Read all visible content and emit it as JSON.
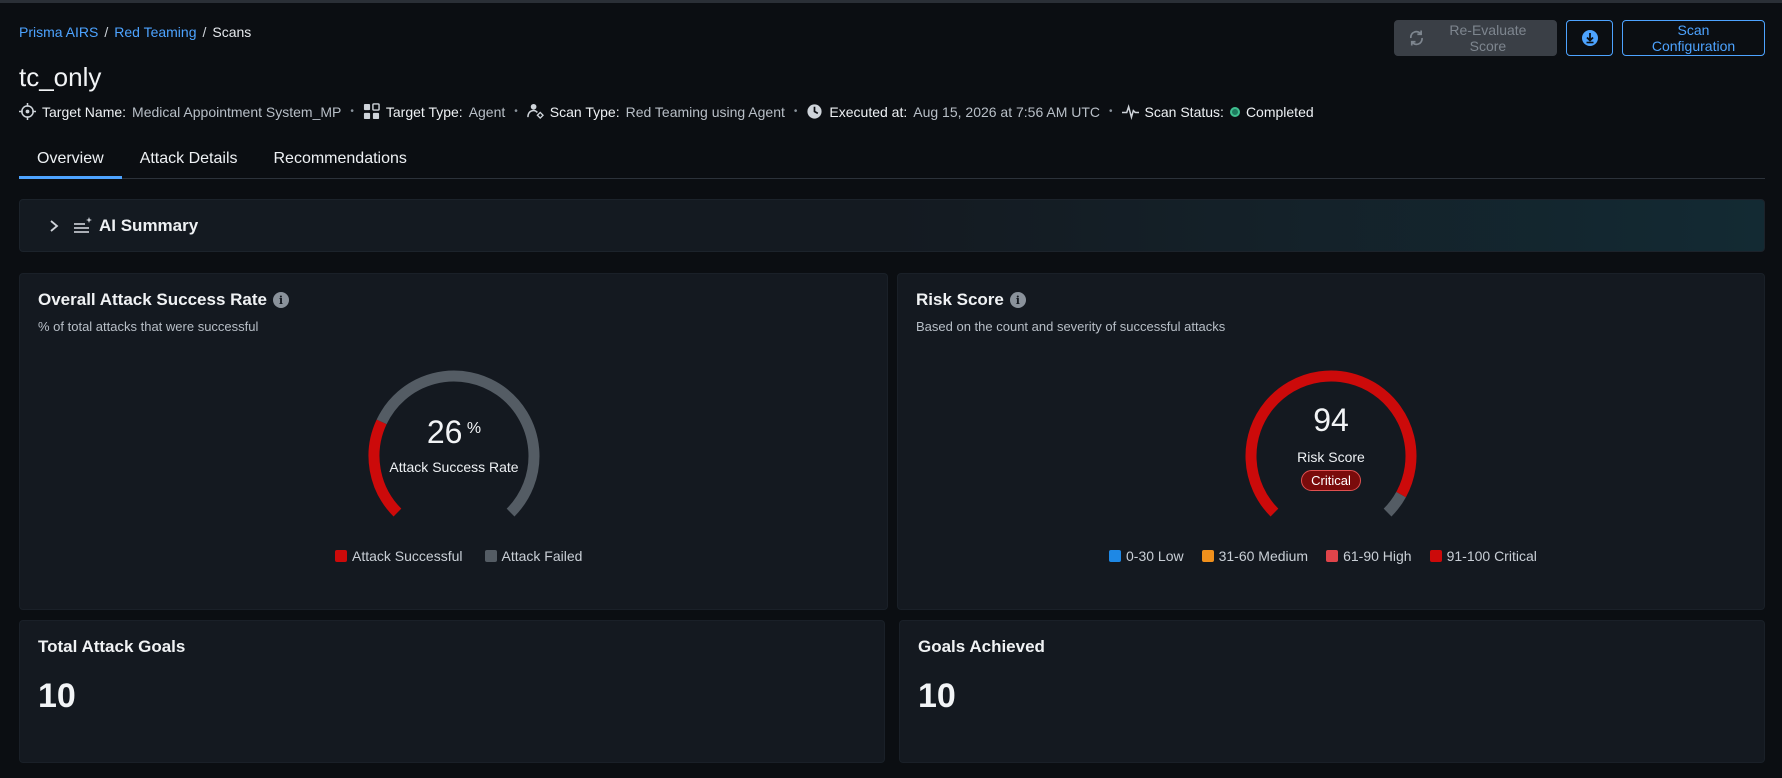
{
  "breadcrumb": {
    "items": [
      "Prisma AIRS",
      "Red Teaming"
    ],
    "separator": "/",
    "current": "Scans"
  },
  "page_title": "tc_only",
  "meta": {
    "target_name_label": "Target Name:",
    "target_name_value": "Medical Appointment System_MP",
    "target_type_label": "Target Type:",
    "target_type_value": "Agent",
    "scan_type_label": "Scan Type:",
    "scan_type_value": "Red Teaming using Agent",
    "executed_label": "Executed at:",
    "executed_value": "Aug 15, 2026 at 7:56 AM UTC",
    "status_label": "Scan Status:",
    "status_value": "Completed",
    "separator": "•"
  },
  "actions": {
    "reevaluate_label": "Re-Evaluate Score",
    "scan_config_label": "Scan Configuration"
  },
  "tabs": [
    {
      "label": "Overview",
      "active": true
    },
    {
      "label": "Attack Details",
      "active": false
    },
    {
      "label": "Recommendations",
      "active": false
    }
  ],
  "ai_summary": {
    "title": "AI Summary"
  },
  "attack_success_card": {
    "title": "Overall Attack Success Rate",
    "subtitle": "% of total attacks that were successful",
    "value": "26",
    "unit": "%",
    "caption": "Attack Success Rate",
    "success_fraction": 0.26,
    "legend": [
      {
        "label": "Attack Successful",
        "color": "#cc0a0a"
      },
      {
        "label": "Attack Failed",
        "color": "#545c64"
      }
    ]
  },
  "risk_score_card": {
    "title": "Risk Score",
    "subtitle": "Based on the count and severity of successful attacks",
    "value": "94",
    "caption": "Risk Score",
    "badge": "Critical",
    "score_fraction": 0.94,
    "legend": [
      {
        "label": "0-30 Low",
        "color": "#1e88e5"
      },
      {
        "label": "31-60 Medium",
        "color": "#f0901c"
      },
      {
        "label": "61-90 High",
        "color": "#e0444a"
      },
      {
        "label": "91-100 Critical",
        "color": "#cc0a0a"
      }
    ]
  },
  "total_goals_card": {
    "title": "Total Attack Goals",
    "value": "10"
  },
  "goals_achieved_card": {
    "title": "Goals Achieved",
    "value": "10"
  },
  "colors": {
    "accent": "#4da3ff",
    "critical": "#cc0a0a",
    "failed": "#545c64",
    "background": "#0b0e12",
    "card": "#141920"
  }
}
